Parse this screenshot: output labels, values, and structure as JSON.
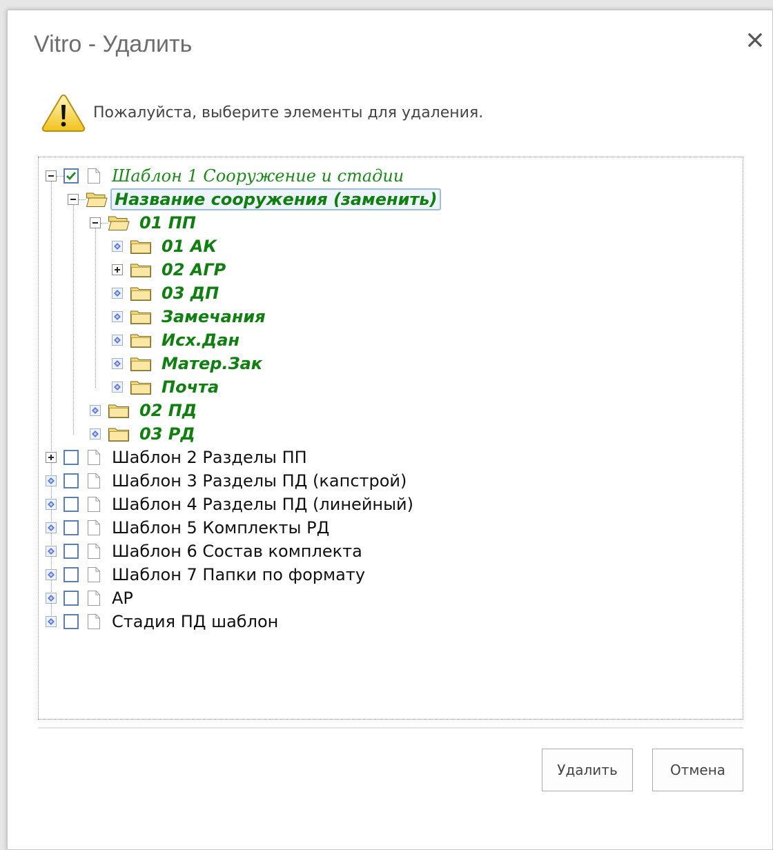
{
  "dialog": {
    "title": "Vitro - Удалить",
    "message": "Пожалуйста, выберите элементы для удаления.",
    "buttons": {
      "delete": "Удалить",
      "cancel": "Отмена"
    }
  },
  "tree": {
    "template1": {
      "label": "Шаблон 1 Сооружение и стадии",
      "checked": true,
      "expanded": true
    },
    "object": {
      "label": "Название сооружения (заменить)",
      "selected": true,
      "expanded": true
    },
    "stage_pp": {
      "label": "01 ПП",
      "expanded": true
    },
    "pp_children": [
      "01 АК",
      "02 АГР",
      "03 ДП",
      "Замечания",
      "Исх.Дан",
      "Матер.Зак",
      "Почта"
    ],
    "stages": [
      "02 ПД",
      "03 РД"
    ],
    "templates": [
      {
        "label": "Шаблон 2 Разделы ПП",
        "checked": false
      },
      {
        "label": "Шаблон 3 Разделы ПД (капстрой)",
        "checked": false
      },
      {
        "label": "Шаблон 4 Разделы ПД (линейный)",
        "checked": false
      },
      {
        "label": "Шаблон 5 Комплекты РД",
        "checked": false
      },
      {
        "label": "Шаблон 6 Состав комплекта",
        "checked": false
      },
      {
        "label": "Шаблон 7 Папки по формату",
        "checked": false
      },
      {
        "label": "АР",
        "checked": false
      },
      {
        "label": "Стадия ПД шаблон",
        "checked": false
      }
    ]
  },
  "colors": {
    "tree_text_green": "#0f7f0f",
    "checkbox_border": "#5a7fae",
    "selection": "#9cbce4"
  }
}
